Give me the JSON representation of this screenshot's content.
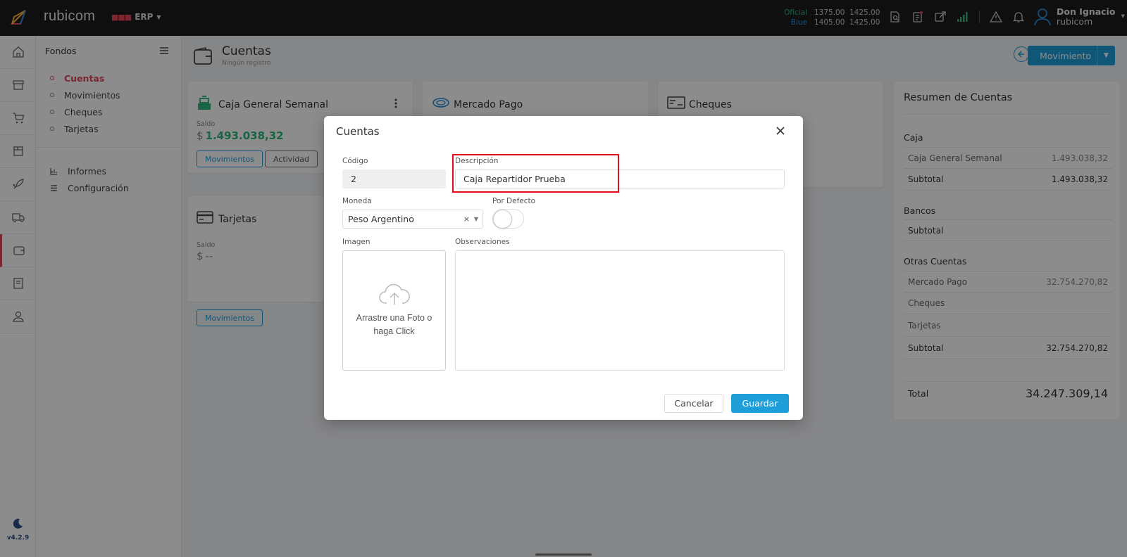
{
  "header": {
    "brand": "rubicom",
    "module": "ERP",
    "rates": [
      {
        "label": "Oficial",
        "buy": "1375.00",
        "sell": "1425.00"
      },
      {
        "label": "Blue",
        "buy": "1405.00",
        "sell": "1425.00"
      }
    ],
    "user": {
      "name": "Don Ignacio",
      "org": "rubicom"
    }
  },
  "rail": {
    "version": "v4.2.9"
  },
  "sidebar": {
    "title": "Fondos",
    "items": [
      {
        "label": "Cuentas"
      },
      {
        "label": "Movimientos"
      },
      {
        "label": "Cheques"
      },
      {
        "label": "Tarjetas"
      }
    ],
    "items2": [
      {
        "label": "Informes"
      },
      {
        "label": "Configuración"
      }
    ]
  },
  "page": {
    "title": "Cuentas",
    "subtitle": "Ningún registro",
    "action_label": "Movimiento"
  },
  "cards": [
    {
      "title": "Caja General Semanal",
      "balance_label": "Saldo",
      "currency": "$",
      "amount": "1.493.038,32",
      "btn1": "Movimientos",
      "btn2": "Actividad"
    },
    {
      "title": "Mercado Pago"
    },
    {
      "title": "Cheques"
    },
    {
      "title": "Tarjetas",
      "balance_label": "Saldo",
      "currency": "$",
      "amount": "--",
      "btn1": "Movimientos"
    }
  ],
  "summary": {
    "title": "Resumen de Cuentas",
    "groups": [
      {
        "name": "Caja",
        "rows": [
          {
            "name": "Caja General Semanal",
            "value": "1.493.038,32"
          }
        ],
        "subtotal_label": "Subtotal",
        "subtotal": "1.493.038,32"
      },
      {
        "name": "Bancos",
        "rows": [],
        "subtotal_label": "Subtotal",
        "subtotal": ""
      },
      {
        "name": "Otras Cuentas",
        "rows": [
          {
            "name": "Mercado Pago",
            "value": "32.754.270,82"
          },
          {
            "name": "Cheques",
            "value": ""
          },
          {
            "name": "Tarjetas",
            "value": ""
          }
        ],
        "subtotal_label": "Subtotal",
        "subtotal": "32.754.270,82"
      }
    ],
    "total_label": "Total",
    "total": "34.247.309,14"
  },
  "modal": {
    "title": "Cuentas",
    "codigo_label": "Código",
    "codigo": "2",
    "descripcion_label": "Descripción",
    "descripcion": "Caja Repartidor Prueba",
    "moneda_label": "Moneda",
    "moneda": "Peso Argentino",
    "por_defecto_label": "Por Defecto",
    "por_defecto": false,
    "imagen_label": "Imagen",
    "dropzone_text": "Arrastre una Foto o haga Click",
    "observaciones_label": "Observaciones",
    "observaciones": "",
    "cancel_label": "Cancelar",
    "save_label": "Guardar"
  },
  "colors": {
    "accent": "#1e9ed9",
    "brand": "#e0455a",
    "positive": "#2eb67d",
    "highlight": "#e0101c"
  }
}
